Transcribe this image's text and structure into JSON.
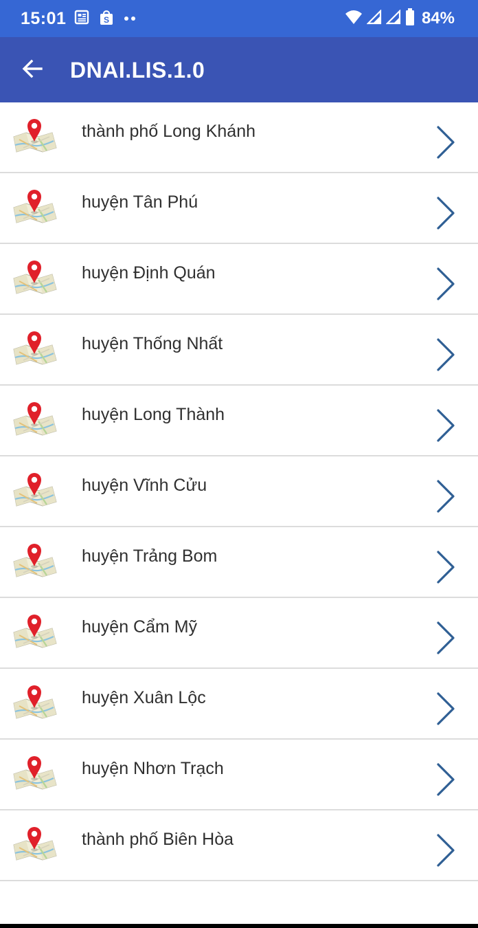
{
  "status_bar": {
    "time": "15:01",
    "battery": "84%",
    "left_icons": [
      "news-icon",
      "shopee-icon",
      "more-dots-icon"
    ],
    "right_icons": [
      "wifi-icon",
      "signal-icon",
      "signal-icon",
      "battery-icon"
    ]
  },
  "app_bar": {
    "title": "DNAI.LIS.1.0",
    "back_icon": "arrow-left-icon"
  },
  "colors": {
    "status_bar": "#3667d4",
    "app_bar": "#3a54b4",
    "chevron": "#2f5f94",
    "pin": "#e0202a",
    "divider": "#dcdcdc"
  },
  "list": {
    "item_icon": "map-pin-icon",
    "item_chevron": "chevron-right-icon",
    "items": [
      {
        "label": "thành phố Long Khánh"
      },
      {
        "label": "huyện Tân Phú"
      },
      {
        "label": "huyện Định Quán"
      },
      {
        "label": "huyện Thống Nhất"
      },
      {
        "label": "huyện Long Thành"
      },
      {
        "label": "huyện Vĩnh Cửu"
      },
      {
        "label": "huyện Trảng Bom"
      },
      {
        "label": "huyện Cẩm Mỹ"
      },
      {
        "label": "huyện Xuân Lộc"
      },
      {
        "label": "huyện Nhơn Trạch"
      },
      {
        "label": "thành phố Biên Hòa"
      }
    ]
  }
}
